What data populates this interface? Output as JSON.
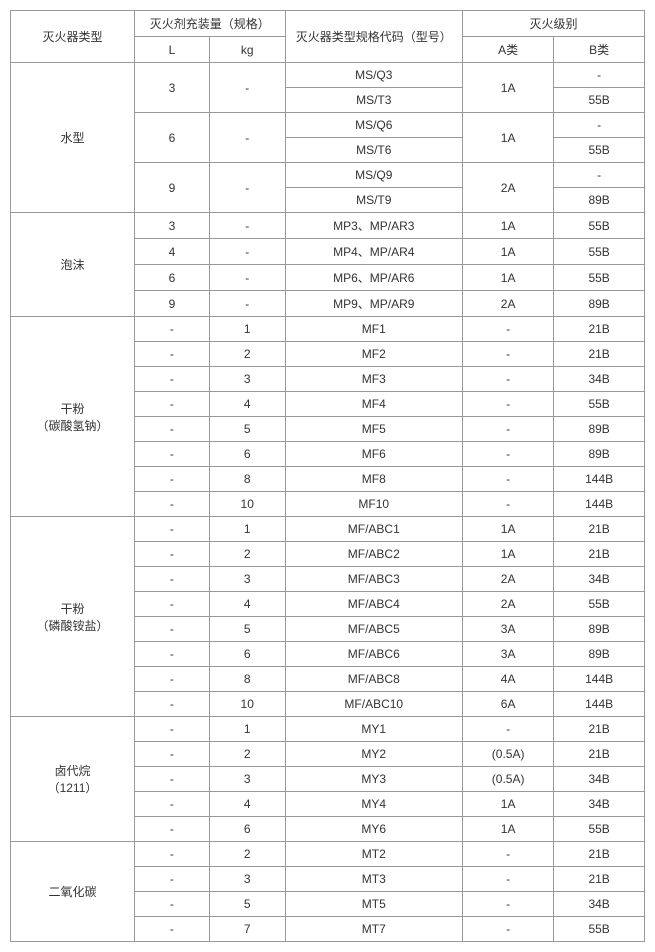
{
  "header": {
    "type": "灭火器类型",
    "charge": "灭火剂充装量（规格）",
    "l": "L",
    "kg": "kg",
    "code": "灭火器类型规格代码（型号）",
    "rating": "灭火级别",
    "a": "A类",
    "b": "B类"
  },
  "groups": [
    {
      "name": "水型",
      "subgroups": [
        {
          "l": "3",
          "kg": "-",
          "rows": [
            {
              "code": "MS/Q3",
              "a": "1A",
              "b": "-",
              "arowspan": 2
            },
            {
              "code": "MS/T3",
              "b": "55B"
            }
          ]
        },
        {
          "l": "6",
          "kg": "-",
          "rows": [
            {
              "code": "MS/Q6",
              "a": "1A",
              "b": "-",
              "arowspan": 2
            },
            {
              "code": "MS/T6",
              "b": "55B"
            }
          ]
        },
        {
          "l": "9",
          "kg": "-",
          "rows": [
            {
              "code": "MS/Q9",
              "a": "2A",
              "b": "-",
              "arowspan": 2
            },
            {
              "code": "MS/T9",
              "b": "89B"
            }
          ]
        }
      ]
    },
    {
      "name": "泡沫",
      "rows": [
        {
          "l": "3",
          "kg": "-",
          "code": "MP3、MP/AR3",
          "a": "1A",
          "b": "55B"
        },
        {
          "l": "4",
          "kg": "-",
          "code": "MP4、MP/AR4",
          "a": "1A",
          "b": "55B"
        },
        {
          "l": "6",
          "kg": "-",
          "code": "MP6、MP/AR6",
          "a": "1A",
          "b": "55B"
        },
        {
          "l": "9",
          "kg": "-",
          "code": "MP9、MP/AR9",
          "a": "2A",
          "b": "89B"
        }
      ]
    },
    {
      "name": "干粉\n（碳酸氢钠）",
      "rows": [
        {
          "l": "-",
          "kg": "1",
          "code": "MF1",
          "a": "-",
          "b": "21B"
        },
        {
          "l": "-",
          "kg": "2",
          "code": "MF2",
          "a": "-",
          "b": "21B"
        },
        {
          "l": "-",
          "kg": "3",
          "code": "MF3",
          "a": "-",
          "b": "34B"
        },
        {
          "l": "-",
          "kg": "4",
          "code": "MF4",
          "a": "-",
          "b": "55B"
        },
        {
          "l": "-",
          "kg": "5",
          "code": "MF5",
          "a": "-",
          "b": "89B"
        },
        {
          "l": "-",
          "kg": "6",
          "code": "MF6",
          "a": "-",
          "b": "89B"
        },
        {
          "l": "-",
          "kg": "8",
          "code": "MF8",
          "a": "-",
          "b": "144B"
        },
        {
          "l": "-",
          "kg": "10",
          "code": "MF10",
          "a": "-",
          "b": "144B"
        }
      ]
    },
    {
      "name": "干粉\n（磷酸铵盐）",
      "rows": [
        {
          "l": "-",
          "kg": "1",
          "code": "MF/ABC1",
          "a": "1A",
          "b": "21B"
        },
        {
          "l": "-",
          "kg": "2",
          "code": "MF/ABC2",
          "a": "1A",
          "b": "21B"
        },
        {
          "l": "-",
          "kg": "3",
          "code": "MF/ABC3",
          "a": "2A",
          "b": "34B"
        },
        {
          "l": "-",
          "kg": "4",
          "code": "MF/ABC4",
          "a": "2A",
          "b": "55B"
        },
        {
          "l": "-",
          "kg": "5",
          "code": "MF/ABC5",
          "a": "3A",
          "b": "89B"
        },
        {
          "l": "-",
          "kg": "6",
          "code": "MF/ABC6",
          "a": "3A",
          "b": "89B"
        },
        {
          "l": "-",
          "kg": "8",
          "code": "MF/ABC8",
          "a": "4A",
          "b": "144B"
        },
        {
          "l": "-",
          "kg": "10",
          "code": "MF/ABC10",
          "a": "6A",
          "b": "144B"
        }
      ]
    },
    {
      "name": "卤代烷\n（1211）",
      "rows": [
        {
          "l": "-",
          "kg": "1",
          "code": "MY1",
          "a": "-",
          "b": "21B"
        },
        {
          "l": "-",
          "kg": "2",
          "code": "MY2",
          "a": "(0.5A)",
          "b": "21B"
        },
        {
          "l": "-",
          "kg": "3",
          "code": "MY3",
          "a": "(0.5A)",
          "b": "34B"
        },
        {
          "l": "-",
          "kg": "4",
          "code": "MY4",
          "a": "1A",
          "b": "34B"
        },
        {
          "l": "-",
          "kg": "6",
          "code": "MY6",
          "a": "1A",
          "b": "55B"
        }
      ]
    },
    {
      "name": "二氧化碳",
      "rows": [
        {
          "l": "-",
          "kg": "2",
          "code": "MT2",
          "a": "-",
          "b": "21B"
        },
        {
          "l": "-",
          "kg": "3",
          "code": "MT3",
          "a": "-",
          "b": "21B"
        },
        {
          "l": "-",
          "kg": "5",
          "code": "MT5",
          "a": "-",
          "b": "34B"
        },
        {
          "l": "-",
          "kg": "7",
          "code": "MT7",
          "a": "-",
          "b": "55B"
        }
      ]
    }
  ]
}
